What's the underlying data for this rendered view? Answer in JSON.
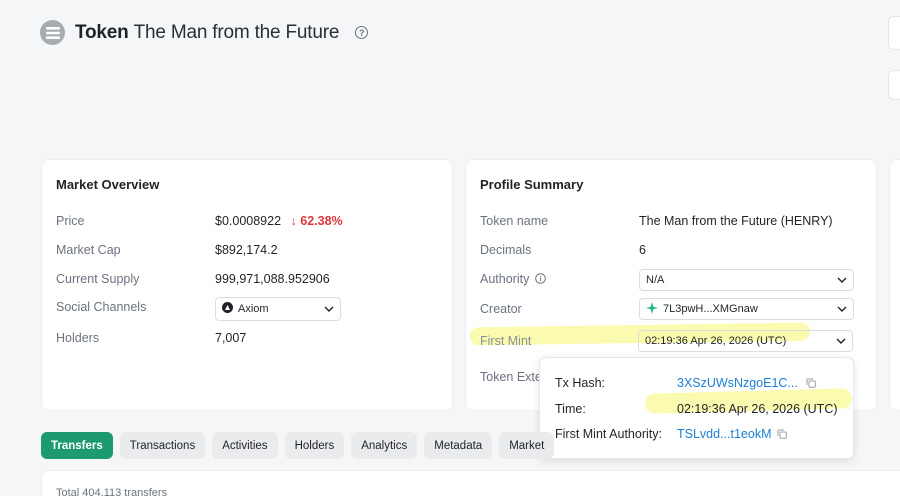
{
  "header": {
    "label": "Token",
    "token_name": "The Man from the Future",
    "help_symbol": "?"
  },
  "market_overview": {
    "title": "Market Overview",
    "price_label": "Price",
    "price_value": "$0.0008922",
    "price_change": "62.38%",
    "price_change_arrow": "↓",
    "market_cap_label": "Market Cap",
    "market_cap_value": "$892,174.2",
    "supply_label": "Current Supply",
    "supply_value": "999,971,088.952906",
    "social_label": "Social Channels",
    "social_value": "Axiom",
    "holders_label": "Holders",
    "holders_value": "7,007"
  },
  "profile_summary": {
    "title": "Profile Summary",
    "token_name_label": "Token name",
    "token_name_value": "The Man from the Future (HENRY)",
    "decimals_label": "Decimals",
    "decimals_value": "6",
    "authority_label": "Authority",
    "authority_value": "N/A",
    "creator_label": "Creator",
    "creator_value": "7L3pwH...XMGnaw",
    "first_mint_label": "First Mint",
    "first_mint_value": "02:19:36 Apr 26, 2026 (UTC)",
    "token_ext_label": "Token Exte"
  },
  "popover": {
    "tx_hash_label": "Tx Hash:",
    "tx_hash_value": "3XSzUWsNzgoE1C...",
    "time_label": "Time:",
    "time_value": "02:19:36 Apr 26, 2026 (UTC)",
    "authority_label": "First Mint Authority:",
    "authority_value": "TSLvdd...t1eokM"
  },
  "tabs": [
    {
      "label": "Transfers",
      "active": true
    },
    {
      "label": "Transactions",
      "active": false
    },
    {
      "label": "Activities",
      "active": false
    },
    {
      "label": "Holders",
      "active": false
    },
    {
      "label": "Analytics",
      "active": false
    },
    {
      "label": "Metadata",
      "active": false
    },
    {
      "label": "Market",
      "active": false
    }
  ],
  "transfers_summary": "Total 404,113 transfers",
  "colors": {
    "accent_green": "#1d9a72",
    "negative_red": "#d93838",
    "link_blue": "#1a7fd6",
    "highlight_yellow": "#f8f86e"
  }
}
